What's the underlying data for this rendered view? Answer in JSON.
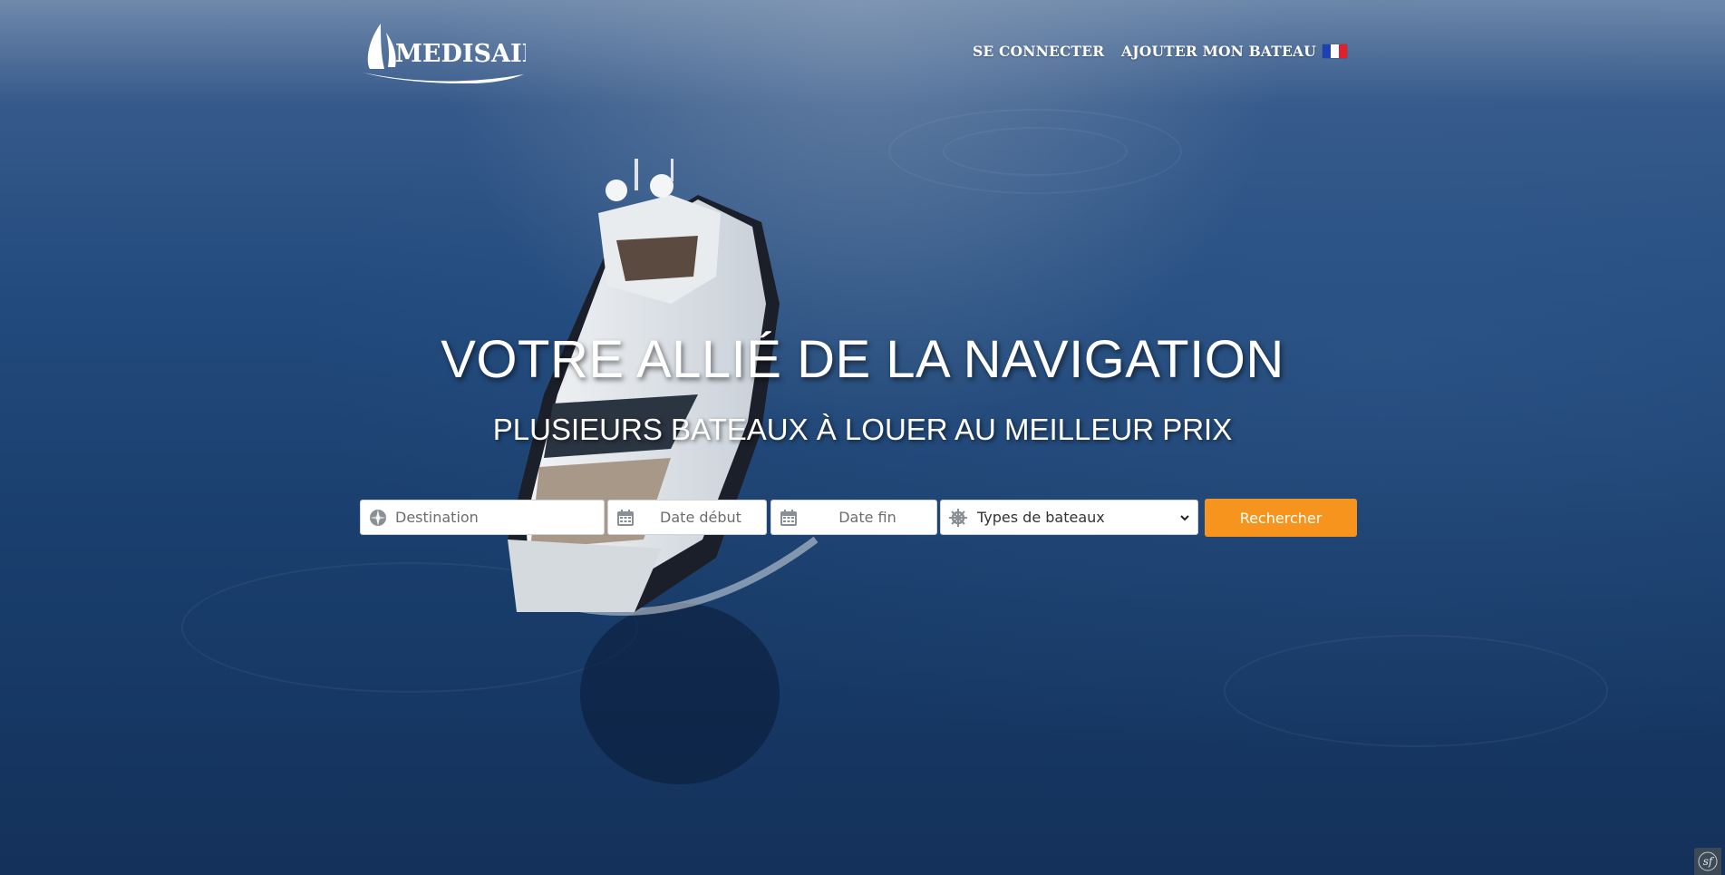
{
  "header": {
    "logo_text": "MEDISAIL",
    "nav": {
      "login": "SE CONNECTER",
      "add_boat": "AJOUTER MON BATEAU"
    },
    "language_flag": "french-flag"
  },
  "hero": {
    "title": "VOTRE ALLIÉ DE LA NAVIGATION",
    "subtitle": "PLUSIEURS BATEAUX À LOUER AU MEILLEUR PRIX"
  },
  "search": {
    "destination_placeholder": "Destination",
    "start_date_placeholder": "Date début",
    "end_date_placeholder": "Date fin",
    "boat_type_selected": "Types de bateaux",
    "submit_label": "Rechercher"
  },
  "colors": {
    "accent": "#f7941d",
    "sea": "#1a3f6e",
    "text_on_hero": "#ffffff"
  },
  "icons": {
    "destination": "compass-icon",
    "start_date": "calendar-icon",
    "end_date": "calendar-icon",
    "boat_type": "helm-icon",
    "debug_toolbar": "symfony-icon"
  }
}
